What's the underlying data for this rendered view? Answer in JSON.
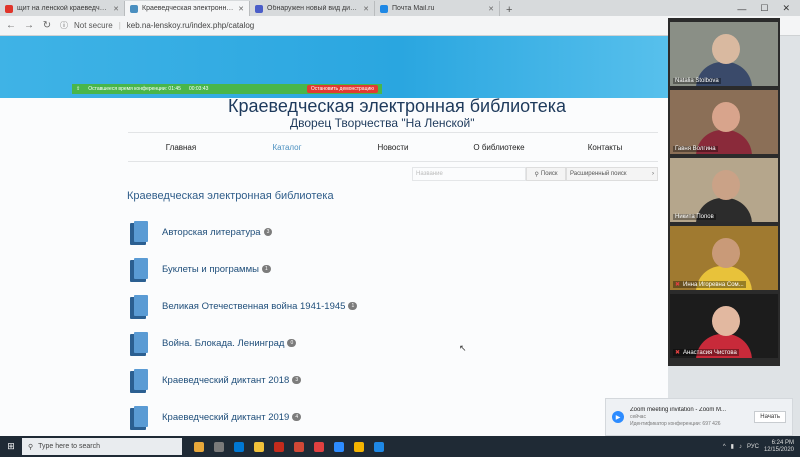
{
  "browser": {
    "tabs": [
      {
        "label": "щит на ленской краеведческ",
        "favicon_color": "#e0342a",
        "active": false
      },
      {
        "label": "Краеведческая электронная б",
        "favicon_color": "#4a8fc0",
        "active": true
      },
      {
        "label": "Обнаружен новый вид диноза",
        "favicon_color": "#4a5dc8",
        "active": false
      },
      {
        "label": "Почта Mail.ru",
        "favicon_color": "#1e88e5",
        "active": false
      }
    ],
    "new_tab": "+",
    "security": "Not secure",
    "url": "keb.na-lenskoy.ru/index.php/catalog"
  },
  "zoom_bar": {
    "time_left_label": "Оставшееся время конференции: 01:45",
    "elapsed": "00:03:43",
    "stop_label": "Остановить демонстрацию"
  },
  "site": {
    "title": "Краеведческая электронная библиотека",
    "subtitle": "Дворец Творчества \"На Ленской\""
  },
  "nav": {
    "items": [
      "Главная",
      "Каталог",
      "Новости",
      "О библиотеке",
      "Контакты"
    ]
  },
  "search": {
    "placeholder": "Название",
    "button": "Поиск",
    "advanced": "Расширенный поиск"
  },
  "catalog": {
    "heading": "Краеведческая электронная библиотека",
    "items": [
      {
        "label": "Авторская литература",
        "count": "3"
      },
      {
        "label": "Буклеты и программы",
        "count": "1"
      },
      {
        "label": "Великая Отечественная война 1941-1945",
        "count": "1"
      },
      {
        "label": "Война. Блокада. Ленинград",
        "count": "0"
      },
      {
        "label": "Краеведческий диктант 2018",
        "count": "3"
      },
      {
        "label": "Краеведческий диктант 2019",
        "count": "4"
      }
    ]
  },
  "participants": [
    {
      "name": "Natalia Stolbova",
      "bg": "#8a8f86",
      "skin": "#d9b9a0",
      "cloth": "#3a4a6a",
      "muted": false
    },
    {
      "name": "Гавня Волгина",
      "bg": "#8b6f57",
      "skin": "#d8a48c",
      "cloth": "#8a2a3a",
      "muted": false
    },
    {
      "name": "Никита Попов",
      "bg": "#b5a68c",
      "skin": "#caa287",
      "cloth": "#2c2c2c",
      "muted": false
    },
    {
      "name": "Инна Игоревна Сом...",
      "bg": "#a07a30",
      "skin": "#c99a78",
      "cloth": "#e8c23a",
      "muted": true
    },
    {
      "name": "Анастасия Чистова",
      "bg": "#1c1c1c",
      "skin": "#e2b8a0",
      "cloth": "#c82a3a",
      "muted": true
    }
  ],
  "toast": {
    "title": "Zoom meeting invitation - Zoom M...",
    "line2": "сейчас",
    "line3": "Идентификатор конференции: 697 426",
    "button": "Начать"
  },
  "taskbar": {
    "search_placeholder": "Type here to search",
    "time": "6:24 PM",
    "date": "12/15/2020",
    "lang": "РУС",
    "app_colors": [
      "#e8a83a",
      "#7a7a7a",
      "#0078d4",
      "#f2c23a",
      "#c42b1c",
      "#d14836",
      "#e04040",
      "#2d8cff",
      "#f4b400",
      "#1e88e5"
    ]
  }
}
